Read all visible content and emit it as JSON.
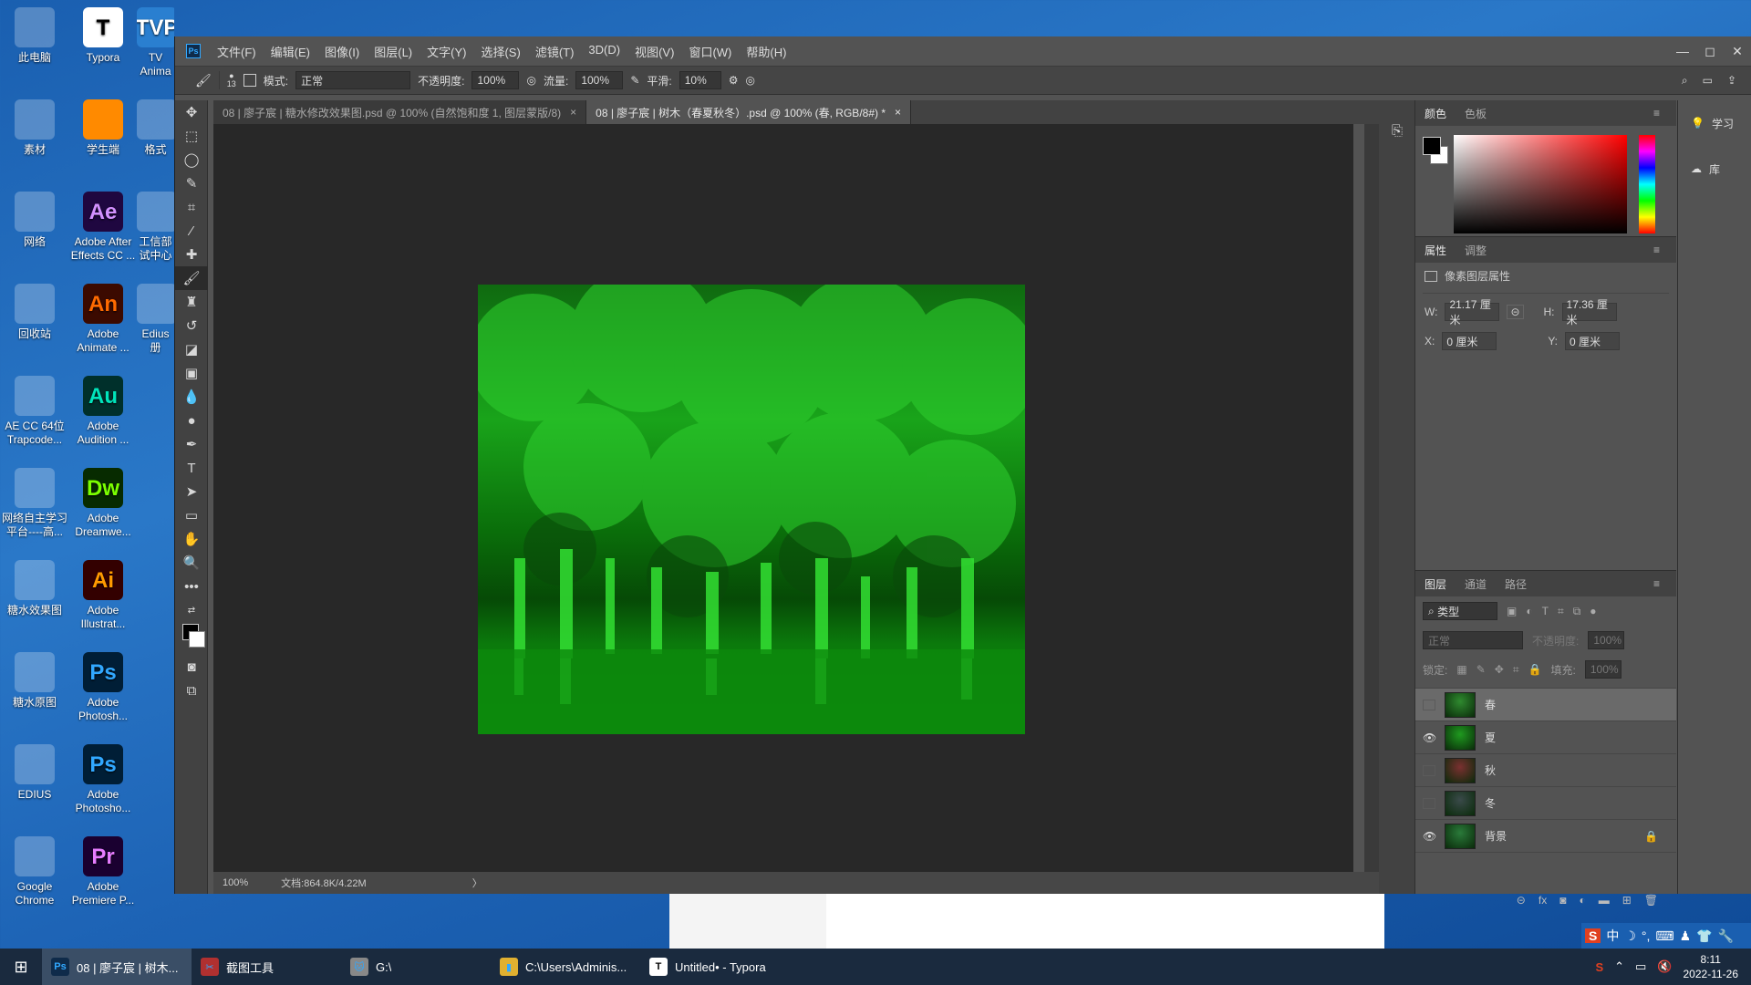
{
  "desktop": {
    "col1": [
      {
        "label": "此电脑",
        "icon": "computer-icon"
      },
      {
        "label": "素材",
        "icon": "folder-icon"
      },
      {
        "label": "网络",
        "icon": "network-icon"
      },
      {
        "label": "回收站",
        "icon": "recycle-bin-icon"
      },
      {
        "label": "AE CC 64位\nTrapcode...",
        "icon": "installer-icon"
      },
      {
        "label": "网络自主学习\n平台----高...",
        "icon": "learning-platform-icon"
      },
      {
        "label": "糖水效果图",
        "icon": "image-icon"
      },
      {
        "label": "糖水原图",
        "icon": "image-icon"
      },
      {
        "label": "EDIUS",
        "icon": "edius-icon"
      },
      {
        "label": "Google\nChrome",
        "icon": "chrome-icon"
      }
    ],
    "col2": [
      {
        "label": "Typora",
        "icon": "typora-icon",
        "glyph": "T"
      },
      {
        "label": "学生端",
        "icon": "student-client-icon",
        "glyph": ""
      },
      {
        "label": "Adobe After\nEffects CC ...",
        "icon": "after-effects-icon",
        "glyph": "Ae"
      },
      {
        "label": "Adobe\nAnimate ...",
        "icon": "animate-icon",
        "glyph": "An"
      },
      {
        "label": "Adobe\nAudition ...",
        "icon": "audition-icon",
        "glyph": "Au"
      },
      {
        "label": "Adobe\nDreamwe...",
        "icon": "dreamweaver-icon",
        "glyph": "Dw"
      },
      {
        "label": "Adobe\nIllustrat...",
        "icon": "illustrator-icon",
        "glyph": "Ai"
      },
      {
        "label": "Adobe\nPhotosh...",
        "icon": "photoshop-icon",
        "glyph": "Ps"
      },
      {
        "label": "Adobe\nPhotosho...",
        "icon": "photoshop-icon",
        "glyph": "Ps"
      },
      {
        "label": "Adobe\nPremiere P...",
        "icon": "premiere-icon",
        "glyph": "Pr"
      }
    ],
    "col3": [
      {
        "label": "TV\nAnima",
        "icon": "tvp-icon",
        "glyph": "TVP"
      },
      {
        "label": "格式",
        "icon": "format-icon",
        "glyph": ""
      },
      {
        "label": "工信部\n试中心",
        "icon": "document-icon",
        "glyph": ""
      },
      {
        "label": "Edius\n册",
        "icon": "document-icon",
        "glyph": ""
      }
    ]
  },
  "photoshop": {
    "logo": "Ps",
    "menu": [
      "文件(F)",
      "编辑(E)",
      "图像(I)",
      "图层(L)",
      "文字(Y)",
      "选择(S)",
      "滤镜(T)",
      "3D(D)",
      "视图(V)",
      "窗口(W)",
      "帮助(H)"
    ],
    "window_buttons": [
      "—",
      "◻",
      "✕"
    ],
    "options": {
      "brush_size": "13",
      "mode_label": "模式:",
      "mode_value": "正常",
      "opacity_label": "不透明度:",
      "opacity_value": "100%",
      "flow_label": "流量:",
      "flow_value": "100%",
      "smooth_label": "平滑:",
      "smooth_value": "10%"
    },
    "tabs": [
      {
        "label": "08 | 廖子宸 | 糖水修改效果图.psd @ 100% (自然饱和度 1, 图层蒙版/8)",
        "close": "×"
      },
      {
        "label": "08 | 廖子宸 | 树木（春夏秋冬）.psd @ 100% (春, RGB/8#) *",
        "close": "×"
      }
    ],
    "status": {
      "zoom": "100%",
      "doc": "文档:864.8K/4.22M",
      "arrow": "〉"
    },
    "color_panel": {
      "tabs": [
        "颜色",
        "色板"
      ]
    },
    "properties": {
      "tabs": [
        "属性",
        "调整"
      ],
      "title": "像素图层属性",
      "w_label": "W:",
      "w_value": "21.17 厘米",
      "h_label": "H:",
      "h_value": "17.36 厘米",
      "x_label": "X:",
      "x_value": "0 厘米",
      "y_label": "Y:",
      "y_value": "0 厘米"
    },
    "layers_panel": {
      "tabs": [
        "图层",
        "通道",
        "路径"
      ],
      "filter": "类型",
      "blend": "正常",
      "opacity_label": "不透明度:",
      "opacity_value": "100%",
      "lock_label": "锁定:",
      "fill_label": "填充:",
      "fill_value": "100%",
      "layers": [
        {
          "name": "春",
          "visible": false,
          "selected": true,
          "thumb": "#2f8a2f"
        },
        {
          "name": "夏",
          "visible": true,
          "selected": false,
          "thumb": "#1f9a1f"
        },
        {
          "name": "秋",
          "visible": false,
          "selected": false,
          "thumb": "#7a3030"
        },
        {
          "name": "冬",
          "visible": false,
          "selected": false,
          "thumb": "#3a4a4a"
        },
        {
          "name": "背景",
          "visible": true,
          "selected": false,
          "thumb": "#2a7a3a",
          "locked": true
        }
      ]
    },
    "learn": [
      {
        "label": "学习",
        "icon": "lightbulb-icon"
      },
      {
        "label": "库",
        "icon": "library-icon"
      }
    ]
  },
  "ime": {
    "items": [
      "S",
      "中",
      "☽",
      "°,",
      "⌨",
      "♟",
      "👕",
      "🔧"
    ]
  },
  "taskbar": {
    "items": [
      {
        "label": "08 | 廖子宸 | 树木...",
        "glyph": "Ps",
        "color": "#0f2b4a",
        "active": true
      },
      {
        "label": "截图工具",
        "glyph": "✂",
        "color": "#b03030",
        "active": false
      },
      {
        "label": "G:\\",
        "glyph": "🐱",
        "color": "#888888",
        "active": false
      },
      {
        "label": "C:\\Users\\Adminis...",
        "glyph": "▮",
        "color": "#e0b030",
        "active": false
      },
      {
        "label": "Untitled• - Typora",
        "glyph": "T",
        "color": "#ffffff",
        "active": false
      }
    ],
    "time": "8:11",
    "date": "2022-11-26"
  },
  "colors": {
    "ps_bg": "#535353",
    "canvas_bg": "#282828",
    "accent": "#31a8ff"
  }
}
